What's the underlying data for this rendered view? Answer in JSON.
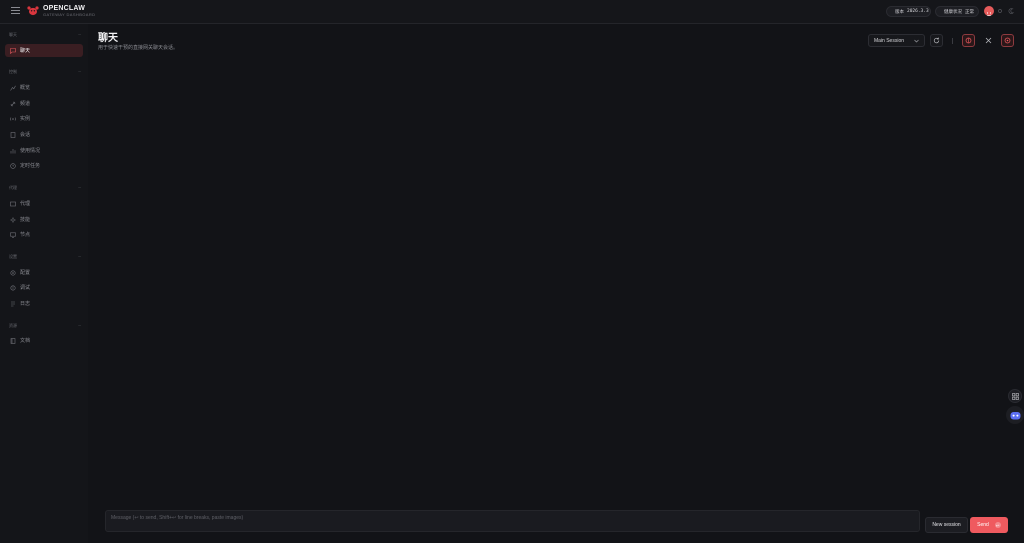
{
  "brand": {
    "name": "OPENCLAW",
    "subtitle": "GATEWAY DASHBOARD"
  },
  "topbar": {
    "version_label": "版本",
    "version_value": "2026.3.3",
    "health_label": "健康状况",
    "health_value": "正常",
    "status_color": "#33c26b",
    "accent": "#ef5a5f"
  },
  "sidebar": {
    "sections": [
      {
        "title": "聊天",
        "items": [
          {
            "label": "聊天",
            "icon": "chat-bubble-icon",
            "active": true
          }
        ]
      },
      {
        "title": "控制",
        "items": [
          {
            "label": "概览",
            "icon": "chart-icon"
          },
          {
            "label": "频道",
            "icon": "link-icon"
          },
          {
            "label": "实例",
            "icon": "radio-icon"
          },
          {
            "label": "会话",
            "icon": "document-icon"
          },
          {
            "label": "使用情况",
            "icon": "bar-chart-icon"
          },
          {
            "label": "定时任务",
            "icon": "clock-icon"
          }
        ]
      },
      {
        "title": "代理",
        "items": [
          {
            "label": "代理",
            "icon": "folder-icon"
          },
          {
            "label": "技能",
            "icon": "sparkle-icon"
          },
          {
            "label": "节点",
            "icon": "monitor-icon"
          }
        ]
      },
      {
        "title": "设置",
        "items": [
          {
            "label": "配置",
            "icon": "settings-icon"
          },
          {
            "label": "调试",
            "icon": "bug-icon"
          },
          {
            "label": "日志",
            "icon": "log-icon"
          }
        ]
      },
      {
        "title": "资源",
        "items": [
          {
            "label": "文档",
            "icon": "book-icon"
          }
        ]
      }
    ]
  },
  "main": {
    "title": "聊天",
    "subtitle": "用于快速干预的直接网关聊天会话。",
    "session_select": "Main Session",
    "composer_placeholder": "Message (↩ to send, Shift+↩ for line breaks, paste images)",
    "new_session_label": "New session",
    "send_label": "Send"
  }
}
